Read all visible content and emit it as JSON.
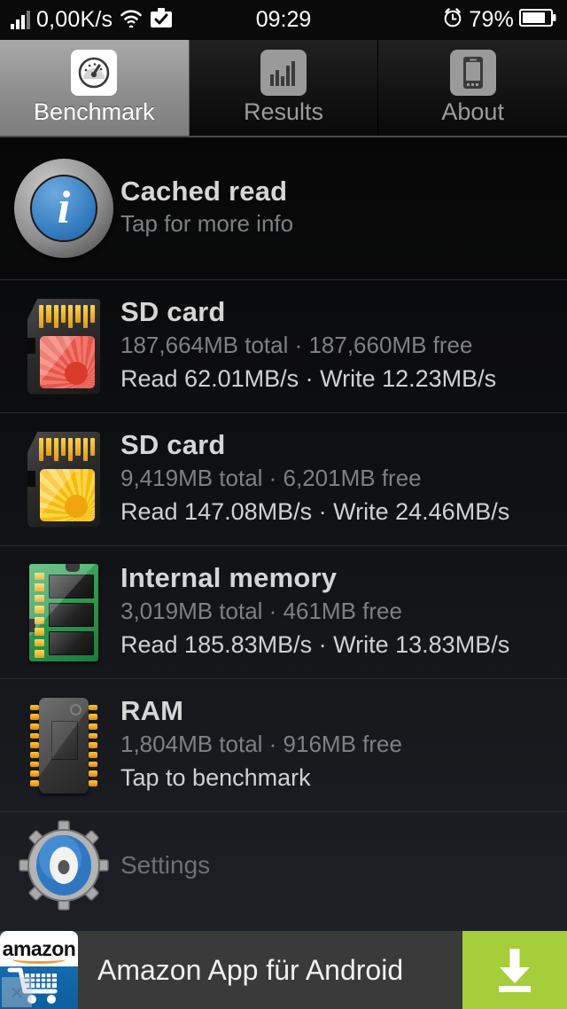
{
  "status_bar": {
    "network_speed": "0,00K/s",
    "time": "09:29",
    "battery_percent": "79%",
    "icons": [
      "signal-bars-icon",
      "wifi-icon",
      "briefcase-check-icon",
      "alarm-clock-icon",
      "battery-icon"
    ]
  },
  "tabs": [
    {
      "label": "Benchmark",
      "icon": "speedometer-icon",
      "active": true
    },
    {
      "label": "Results",
      "icon": "bar-chart-icon",
      "active": false
    },
    {
      "label": "About",
      "icon": "phone-icon",
      "active": false
    }
  ],
  "list": {
    "header": {
      "title": "Cached read",
      "subtitle": "Tap for more info",
      "icon": "info-icon"
    },
    "items": [
      {
        "title": "SD card",
        "capacity": "187,664MB total · 187,660MB free",
        "detail": "Read 62.01MB/s · Write 12.23MB/s",
        "icon": "sd-card-icon",
        "icon_color": "#e2574b",
        "benchmarked": true
      },
      {
        "title": "SD card",
        "capacity": "9,419MB total · 6,201MB free",
        "detail": "Read 147.08MB/s · Write 24.46MB/s",
        "icon": "sd-card-icon",
        "icon_color": "#f5b915",
        "benchmarked": true
      },
      {
        "title": "Internal memory",
        "capacity": "3,019MB total · 461MB free",
        "detail": "Read 185.83MB/s · Write 13.83MB/s",
        "icon": "memory-module-icon",
        "icon_color": "#2f9a53",
        "benchmarked": true
      },
      {
        "title": "RAM",
        "capacity": "1,804MB total · 916MB free",
        "detail": "Tap to benchmark",
        "icon": "ram-chip-icon",
        "icon_color": "#3a3a3a",
        "benchmarked": false
      }
    ],
    "settings": {
      "label": "Settings",
      "icon": "gear-icon"
    }
  },
  "ad": {
    "text": "Amazon App für Android",
    "brand": "amazon",
    "icon": "amazon-cart-icon",
    "close_label": "×",
    "cta_icon": "download-icon",
    "cta_color": "#a6ce3a"
  }
}
